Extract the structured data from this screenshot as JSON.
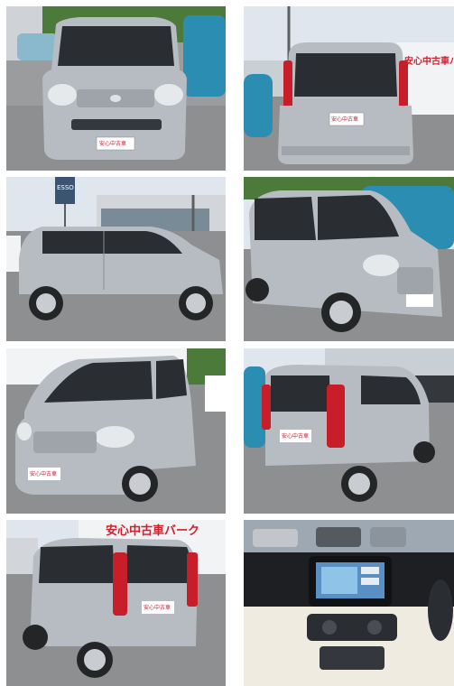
{
  "gallery": {
    "photos": [
      {
        "view": "front"
      },
      {
        "view": "rear"
      },
      {
        "view": "side-right"
      },
      {
        "view": "front-three-quarter-right"
      },
      {
        "view": "front-three-quarter-left"
      },
      {
        "view": "rear-three-quarter-right"
      },
      {
        "view": "rear-three-quarter-left"
      },
      {
        "view": "interior-dashboard"
      }
    ],
    "plate_text": "安心中古車",
    "dealer_sign": "安心中古車バーク",
    "pole_sign": "ESSO",
    "colors": {
      "car_body": "#b7bcc2",
      "car_dark": "#2a2d31",
      "sky": "#dfe6ee",
      "asphalt": "#8d8f91",
      "taillight": "#c81e2a",
      "teal_car": "#2c8db3",
      "sign_red": "#d21f2c"
    }
  }
}
